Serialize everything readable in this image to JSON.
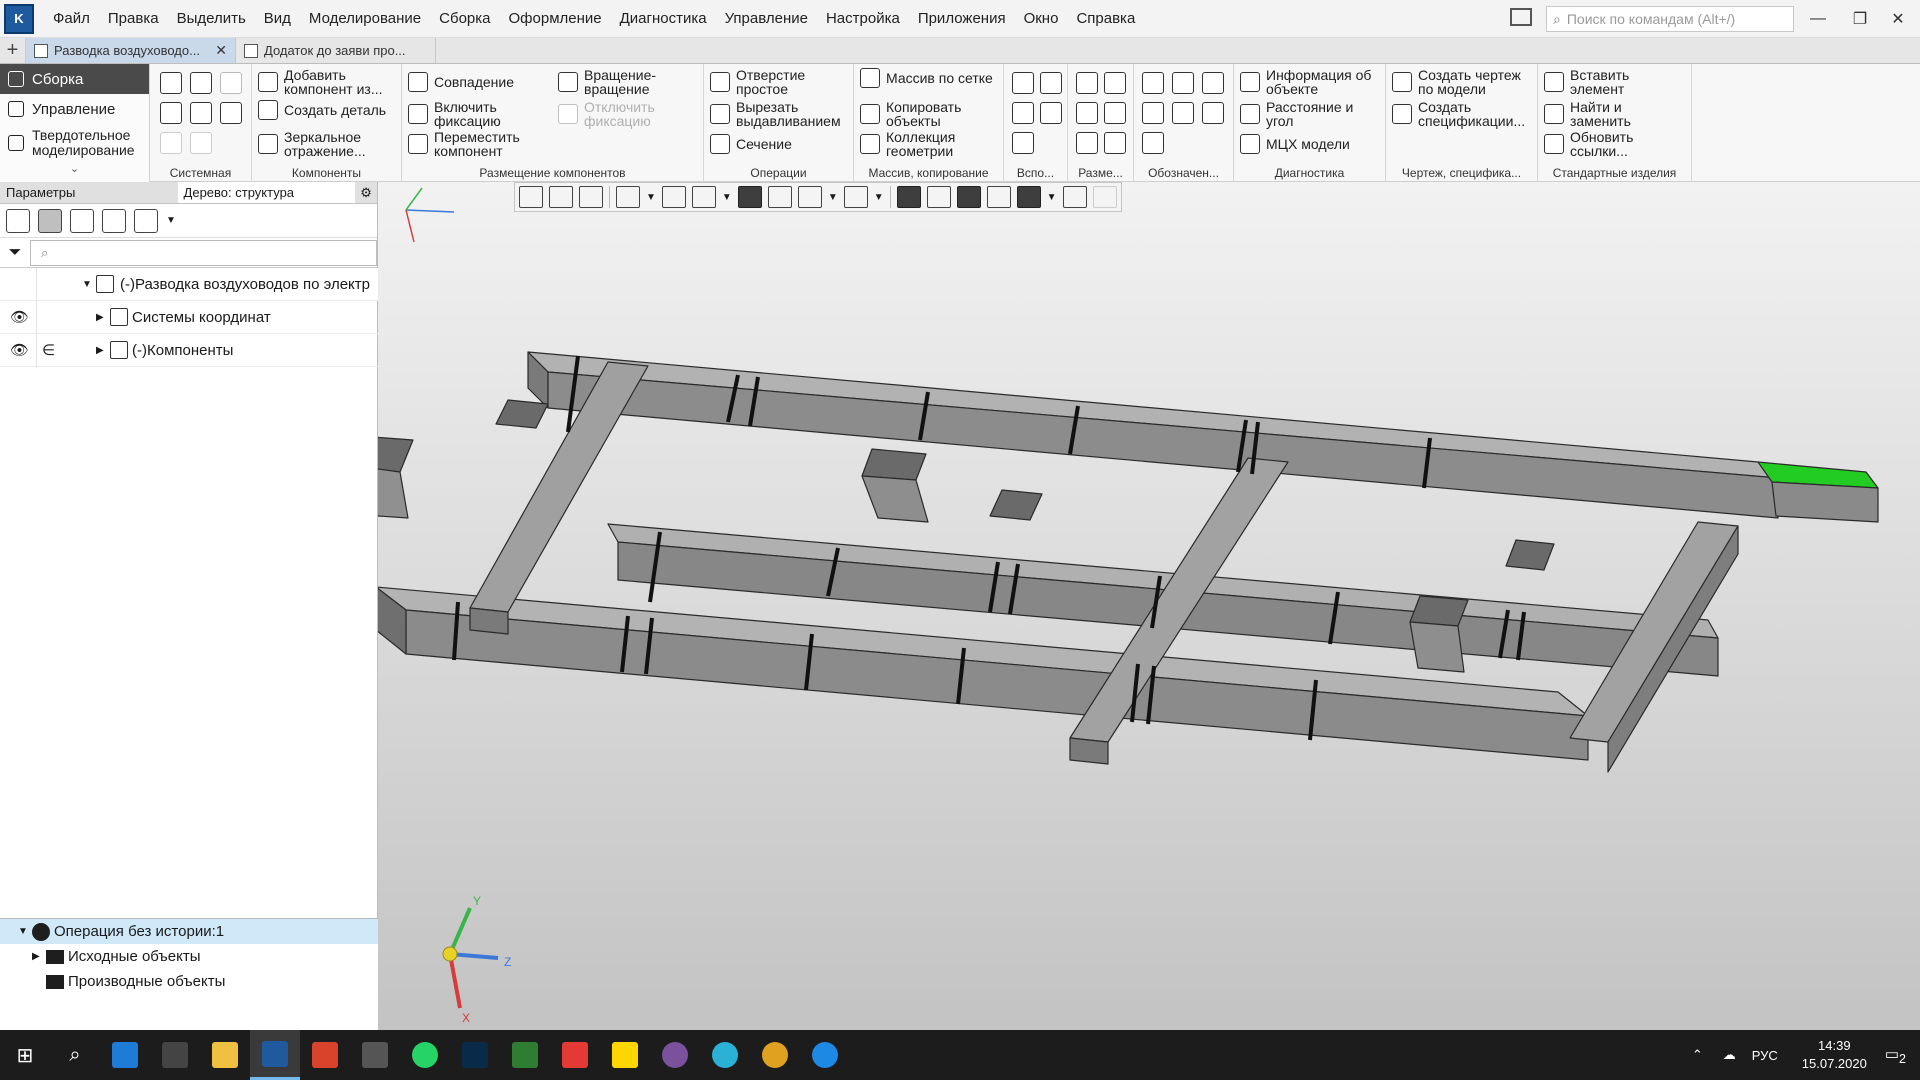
{
  "menubar": {
    "items": [
      "Файл",
      "Правка",
      "Выделить",
      "Вид",
      "Моделирование",
      "Сборка",
      "Оформление",
      "Диагностика",
      "Управление",
      "Настройка",
      "Приложения",
      "Окно",
      "Справка"
    ],
    "search_placeholder": "Поиск по командам (Alt+/)"
  },
  "tabs": [
    {
      "label": "Разводка воздуховодо...",
      "active": true
    },
    {
      "label": "Додаток до заяви про...",
      "active": false
    }
  ],
  "modes": {
    "assembly": "Сборка",
    "control": "Управление",
    "solid": "Твердотельное моделирование"
  },
  "ribbon": {
    "groups": {
      "system": "Системная",
      "components": "Компоненты",
      "placement": "Размещение компонентов",
      "operations": "Операции",
      "array": "Массив, копирование",
      "aux": "Вспо...",
      "dims": "Разме...",
      "designations": "Обозначен...",
      "diagnostics": "Диагностика",
      "drawing": "Чертеж, специфика...",
      "standard": "Стандартные изделия"
    },
    "buttons": {
      "add_component": "Добавить компонент из...",
      "create_part": "Создать деталь",
      "mirror": "Зеркальное отражение...",
      "coincidence": "Совпадение",
      "enable_fix": "Включить фиксацию",
      "move_component": "Переместить компонент",
      "rotate": "Вращение-вращение",
      "disable_fix": "Отключить фиксацию",
      "hole": "Отверстие простое",
      "extrude_cut": "Вырезать выдавливанием",
      "section": "Сечение",
      "grid_array": "Массив по сетке",
      "copy_objects": "Копировать объекты",
      "geometry_collection": "Коллекция геометрии",
      "object_info": "Информация об объекте",
      "distance_angle": "Расстояние и угол",
      "mass_props": "МЦХ модели",
      "create_drawing": "Создать чертеж по модели",
      "create_spec": "Создать спецификации...",
      "insert_element": "Вставить элемент",
      "find_replace": "Найти и заменить",
      "update_links": "Обновить ссылки..."
    }
  },
  "left_panel": {
    "tab_params": "Параметры",
    "tab_tree": "Дерево: структура",
    "tree": {
      "root": "(-)Разводка воздуховодов по электр",
      "coords": "Системы координат",
      "components": "(-)Компоненты"
    },
    "ops": {
      "op": "Операция без истории:1",
      "source": "Исходные объекты",
      "derived": "Производные объекты"
    }
  },
  "viewport": {
    "highlight_color": "#22cc22",
    "duct_color": "#8e8e8e"
  },
  "taskbar": {
    "lang": "РУС",
    "time": "14:39",
    "date": "15.07.2020",
    "notif_count": "2"
  }
}
